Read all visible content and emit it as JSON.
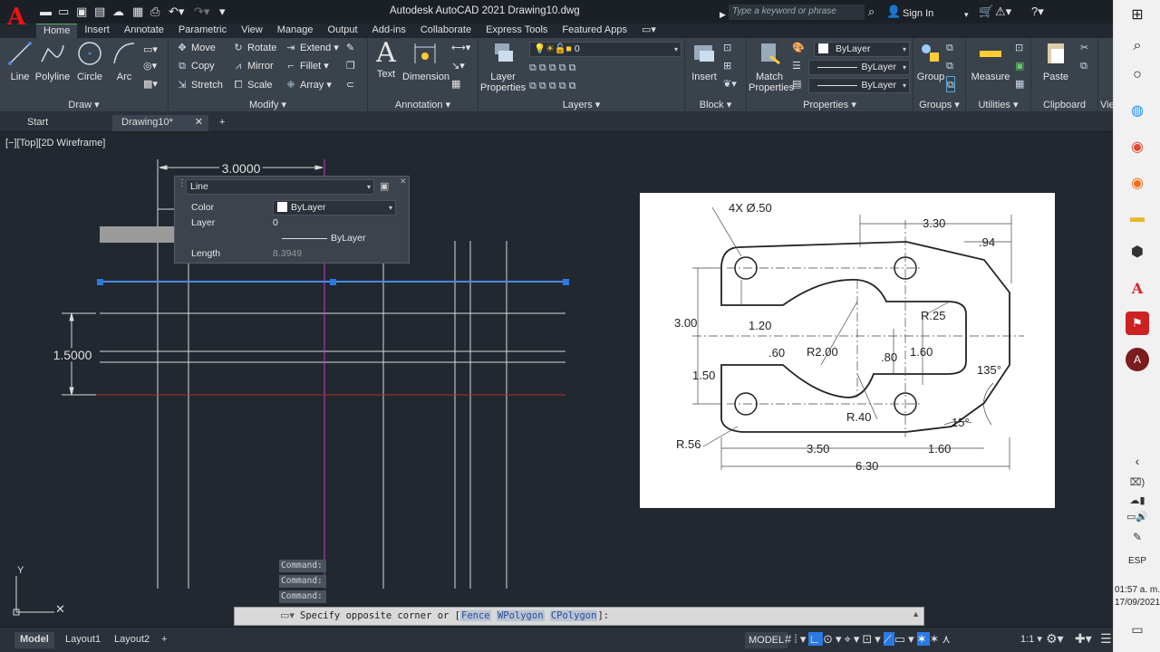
{
  "app": {
    "title": "Autodesk AutoCAD 2021   Drawing10.dwg",
    "search_placeholder": "Type a keyword or phrase",
    "sign_in": "Sign In"
  },
  "ribbon_tabs": [
    "Home",
    "Insert",
    "Annotate",
    "Parametric",
    "View",
    "Manage",
    "Output",
    "Add-ins",
    "Collaborate",
    "Express Tools",
    "Featured Apps"
  ],
  "draw_panel": {
    "title": "Draw",
    "line": "Line",
    "polyline": "Polyline",
    "circle": "Circle",
    "arc": "Arc"
  },
  "modify_panel": {
    "title": "Modify",
    "move": "Move",
    "rotate": "Rotate",
    "extend": "Extend",
    "copy": "Copy",
    "mirror": "Mirror",
    "fillet": "Fillet",
    "stretch": "Stretch",
    "scale": "Scale",
    "array": "Array"
  },
  "annotation_panel": {
    "title": "Annotation",
    "text": "Text",
    "dimension": "Dimension"
  },
  "layers_panel": {
    "title": "Layers",
    "layer_properties_1": "Layer",
    "layer_properties_2": "Properties",
    "current_layer": "0"
  },
  "block_panel": {
    "title": "Block",
    "insert": "Insert"
  },
  "properties_panel": {
    "title": "Properties",
    "match_1": "Match",
    "match_2": "Properties",
    "color": "ByLayer",
    "linetype": "ByLayer",
    "lineweight": "ByLayer"
  },
  "groups_panel": {
    "title": "Groups",
    "group": "Group"
  },
  "utilities_panel": {
    "title": "Utilities",
    "measure": "Measure"
  },
  "clipboard_panel": {
    "title": "Clipboard",
    "paste": "Paste"
  },
  "view_panel_partial": "Vie",
  "file_tabs": {
    "start": "Start",
    "drawing": "Drawing10*"
  },
  "viewport_label": "[−][Top][2D Wireframe]",
  "dimensions": {
    "horizontal": "3.0000",
    "vertical": "1.5000"
  },
  "quick_properties": {
    "object_type": "Line",
    "rows": [
      {
        "key": "Color",
        "value": "ByLayer"
      },
      {
        "key": "Layer",
        "value": "0"
      },
      {
        "key": "",
        "value": "ByLayer"
      },
      {
        "key": "Length",
        "value": "8.3949"
      }
    ]
  },
  "reference_drawing": {
    "labels": [
      "4X Ø.50",
      "3.30",
      ".94",
      "R.25",
      "3.00",
      "1.20",
      ".60",
      "R2.00",
      ".80",
      "1.60",
      "1.50",
      "135°",
      "R.40",
      "15°",
      "R.56",
      "3.50",
      "1.60",
      "6.30"
    ]
  },
  "command_history": [
    "Command:",
    "Command:",
    "Command:"
  ],
  "command_line": {
    "prompt": "Specify opposite corner or [",
    "opt1": "Fence",
    "opt2": "WPolygon",
    "opt3": "CPolygon",
    "end": "]:"
  },
  "layout_tabs": [
    "Model",
    "Layout1",
    "Layout2"
  ],
  "status": {
    "model": "MODEL",
    "scale": "1:1"
  },
  "system": {
    "language": "ESP",
    "time": "01:57 a. m.",
    "date": "17/09/2021"
  }
}
